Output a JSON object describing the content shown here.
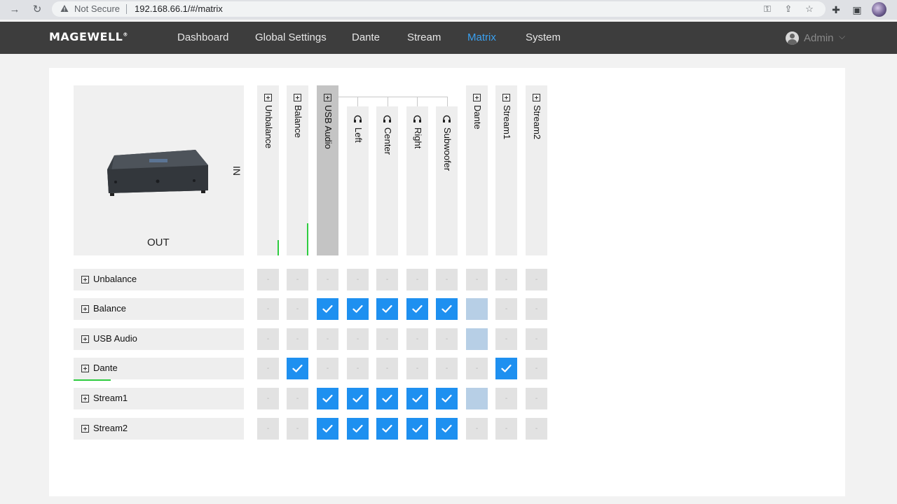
{
  "browser": {
    "security_label": "Not Secure",
    "url": "192.168.66.1/#/matrix"
  },
  "app": {
    "logo": "MAGEWELL",
    "nav": [
      "Dashboard",
      "Global Settings",
      "Dante",
      "Stream",
      "Matrix",
      "System"
    ],
    "active_nav": "Matrix",
    "user": "Admin"
  },
  "matrix": {
    "in_label": "IN",
    "out_label": "OUT",
    "columns": [
      "Unbalance",
      "Balance",
      "USB Audio",
      "Left",
      "Center",
      "Right",
      "Subwoofer",
      "Dante",
      "Stream1",
      "Stream2"
    ],
    "rows": [
      "Unbalance",
      "Balance",
      "USB Audio",
      "Dante",
      "Stream1",
      "Stream2"
    ],
    "empty_mark": "-",
    "cells": [
      [
        "-",
        "-",
        "-",
        "-",
        "-",
        "-",
        "-",
        "-",
        "-",
        "-"
      ],
      [
        "-",
        "-",
        "on",
        "on",
        "on",
        "on",
        "on",
        "disabled",
        "-",
        "-"
      ],
      [
        "-",
        "-",
        "-",
        "-",
        "-",
        "-",
        "-",
        "disabled",
        "-",
        "-"
      ],
      [
        "-",
        "on",
        "-",
        "-",
        "-",
        "-",
        "-",
        "-",
        "on",
        "-"
      ],
      [
        "-",
        "-",
        "on",
        "on",
        "on",
        "on",
        "on",
        "disabled",
        "-",
        "-"
      ],
      [
        "-",
        "-",
        "on",
        "on",
        "on",
        "on",
        "on",
        "-",
        "-",
        "-"
      ]
    ],
    "selected_column": "USB Audio"
  },
  "colors": {
    "accent": "#1e90f0",
    "nav_active": "#3aa0f0",
    "header_bg": "#3d3d3d",
    "level_meter": "#2ecc40"
  }
}
